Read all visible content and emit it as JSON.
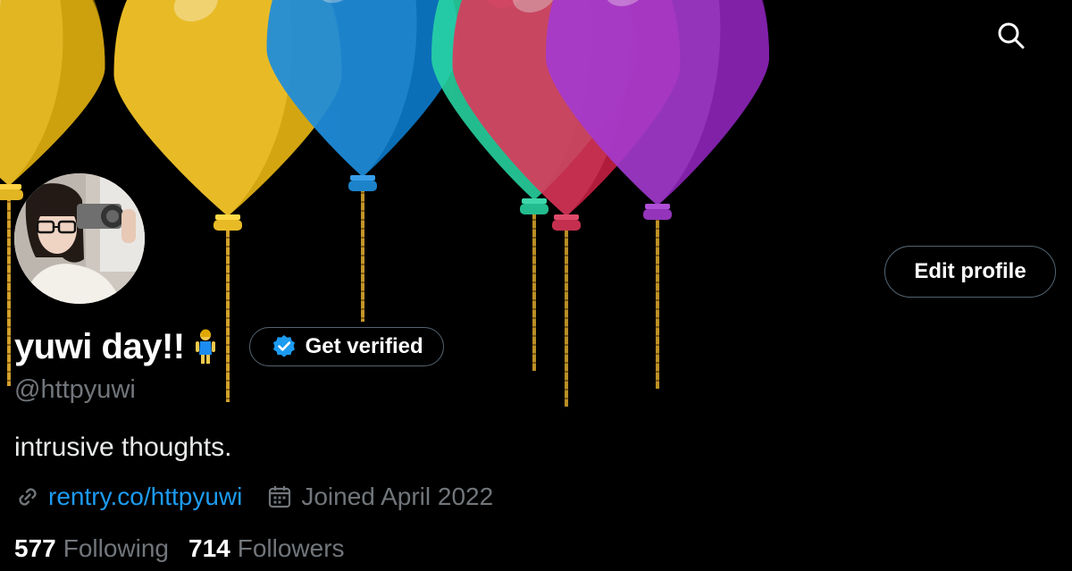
{
  "header": {
    "search_icon": "search-icon",
    "balloon_colors": [
      "#e2b523",
      "#e8bb26",
      "#1f8ddb",
      "#28d7a3",
      "#e0365a",
      "#a43ad0"
    ]
  },
  "profile": {
    "display_name": "yuwi day!!",
    "name_emoji": "person-emoji",
    "verify_label": "Get verified",
    "edit_label": "Edit profile",
    "handle": "@httpyuwi",
    "bio": "intrusive thoughts.",
    "link": "rentry.co/httpyuwi",
    "joined": "Joined April 2022",
    "following_count": "577",
    "following_label": "Following",
    "followers_count": "714",
    "followers_label": "Followers"
  },
  "colors": {
    "background": "#000000",
    "link": "#1d9bf0",
    "muted": "#71767b",
    "verified_badge": "#1d9bf0"
  }
}
